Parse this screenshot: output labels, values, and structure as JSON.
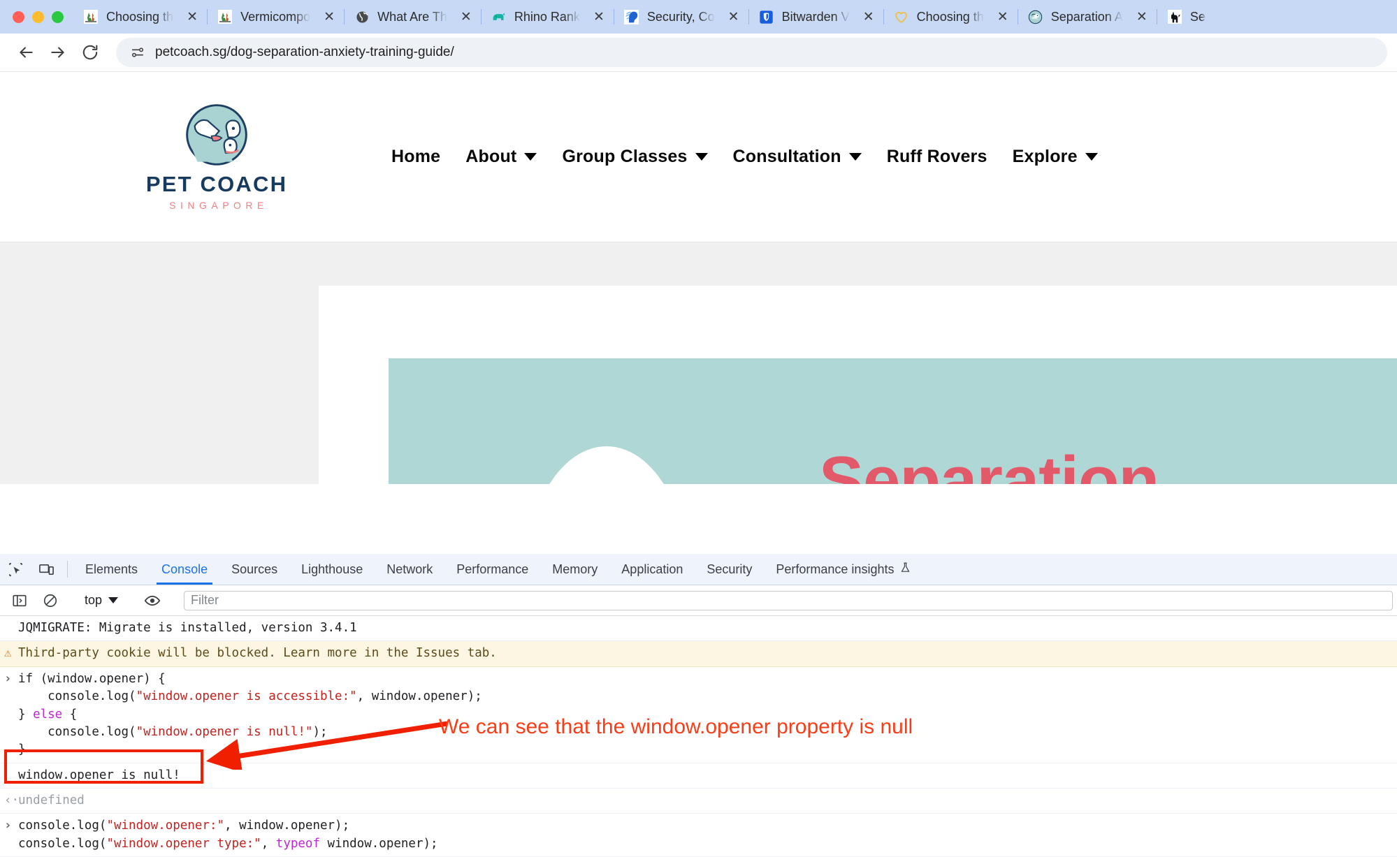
{
  "browser": {
    "tabs": [
      {
        "title": "Choosing th",
        "favicon": "site-icon-choosing",
        "close_label": "✕"
      },
      {
        "title": "Vermicompo",
        "favicon": "site-icon-vermicompost",
        "close_label": "✕"
      },
      {
        "title": "What Are Th",
        "favicon": "globe-icon",
        "close_label": "✕"
      },
      {
        "title": "Rhino Rank",
        "favicon": "rhino-icon",
        "close_label": "✕"
      },
      {
        "title": "Security, Co",
        "favicon": "security-head-icon",
        "close_label": "✕"
      },
      {
        "title": "Bitwarden V",
        "favicon": "bitwarden-shield-icon",
        "close_label": "✕"
      },
      {
        "title": "Choosing th",
        "favicon": "heart-icon",
        "close_label": "✕"
      },
      {
        "title": "Separation A",
        "favicon": "paw-circle-icon",
        "close_label": "✕"
      },
      {
        "title": "Se",
        "favicon": "dog-icon",
        "close_label": "✕"
      }
    ],
    "toolbar": {
      "back_label": "←",
      "forward_label": "→",
      "reload_label": "↻",
      "site_info_icon": "tune-icon",
      "url": "petcoach.sg/dog-separation-anxiety-training-guide/"
    }
  },
  "site": {
    "brand": {
      "logo_icon": "pet-coach-circle-logo",
      "name": "PET COACH",
      "sub": "SINGAPORE"
    },
    "nav": [
      {
        "label": "Home",
        "has_dropdown": false
      },
      {
        "label": "About",
        "has_dropdown": true
      },
      {
        "label": "Group Classes",
        "has_dropdown": true
      },
      {
        "label": "Consultation",
        "has_dropdown": true
      },
      {
        "label": "Ruff Rovers",
        "has_dropdown": false
      },
      {
        "label": "Explore",
        "has_dropdown": true
      }
    ],
    "hero": {
      "title": "Separation",
      "bg_color": "#aed7d6",
      "title_color": "#e2596a"
    }
  },
  "devtools": {
    "inspect_icon": "inspect-element-icon",
    "device_icon": "device-toolbar-icon",
    "tabs": [
      {
        "label": "Elements",
        "active": false
      },
      {
        "label": "Console",
        "active": true
      },
      {
        "label": "Sources",
        "active": false
      },
      {
        "label": "Lighthouse",
        "active": false
      },
      {
        "label": "Network",
        "active": false
      },
      {
        "label": "Performance",
        "active": false
      },
      {
        "label": "Memory",
        "active": false
      },
      {
        "label": "Application",
        "active": false
      },
      {
        "label": "Security",
        "active": false
      },
      {
        "label": "Performance insights",
        "active": false,
        "badge_icon": "flask-icon"
      }
    ],
    "console_toolbar": {
      "sidebar_icon": "console-sidebar-icon",
      "clear_icon": "clear-console-icon",
      "context": "top",
      "eye_icon": "live-expression-eye-icon",
      "filter_placeholder": "Filter"
    },
    "console_rows": [
      {
        "kind": "log",
        "glyph": "",
        "segments": [
          {
            "t": "JQMIGRATE: Migrate is installed, version 3.4.1",
            "c": "plain"
          }
        ]
      },
      {
        "kind": "warning",
        "glyph": "⚠",
        "segments": [
          {
            "t": "Third-party cookie will be blocked. Learn more in the Issues tab.",
            "c": "plain"
          }
        ]
      },
      {
        "kind": "input",
        "glyph": "›",
        "segments": [
          {
            "t": "if (window.opener) {\n    console.log(",
            "c": "plain"
          },
          {
            "t": "\"window.opener is accessible:\"",
            "c": "str"
          },
          {
            "t": ", window.opener);\n} ",
            "c": "plain"
          },
          {
            "t": "else",
            "c": "kw"
          },
          {
            "t": " {\n    console.log(",
            "c": "plain"
          },
          {
            "t": "\"window.opener is null!\"",
            "c": "str"
          },
          {
            "t": ");\n}",
            "c": "plain"
          }
        ]
      },
      {
        "kind": "output",
        "glyph": "",
        "segments": [
          {
            "t": "window.opener is null!",
            "c": "plain"
          }
        ]
      },
      {
        "kind": "result",
        "glyph": "‹·",
        "segments": [
          {
            "t": "undefined",
            "c": "plain"
          }
        ]
      },
      {
        "kind": "input",
        "glyph": "›",
        "segments": [
          {
            "t": "console.log(",
            "c": "plain"
          },
          {
            "t": "\"window.opener:\"",
            "c": "str"
          },
          {
            "t": ", window.opener);\nconsole.log(",
            "c": "plain"
          },
          {
            "t": "\"window.opener type:\"",
            "c": "str"
          },
          {
            "t": ", ",
            "c": "plain"
          },
          {
            "t": "typeof",
            "c": "kw"
          },
          {
            "t": " window.opener);",
            "c": "plain"
          }
        ]
      }
    ]
  },
  "annotation": {
    "text": "We can see that the window.opener property is null",
    "color": "#fb3d17",
    "highlight_box_color": "#f01f00"
  }
}
